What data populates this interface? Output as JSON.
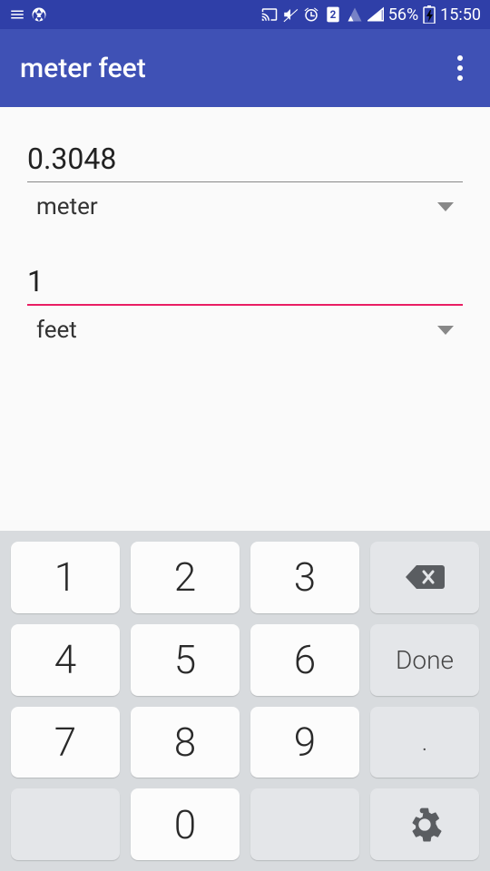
{
  "status_bar": {
    "battery_pct": "56%",
    "time": "15:50"
  },
  "app_bar": {
    "title": "meter feet"
  },
  "fields": {
    "value1": "0.3048",
    "unit1": "meter",
    "value2": "1",
    "unit2": "feet"
  },
  "keyboard": {
    "k1": "1",
    "k2": "2",
    "k3": "3",
    "k4": "4",
    "k5": "5",
    "k6": "6",
    "done": "Done",
    "k7": "7",
    "k8": "8",
    "k9": "9",
    "dot": ".",
    "k0": "0"
  }
}
